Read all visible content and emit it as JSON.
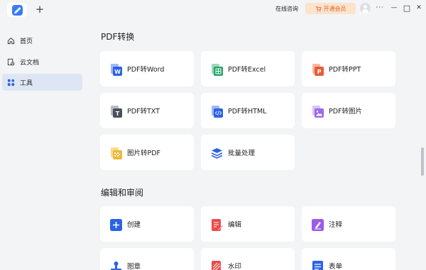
{
  "titlebar": {
    "new_tab": "+",
    "online_consult": "在线咨询",
    "vip_label": "开通会员",
    "more": "···",
    "minimize": "—",
    "maximize": "□",
    "close": "✕"
  },
  "sidebar": {
    "items": [
      {
        "label": "首页",
        "icon": "home-icon",
        "active": false
      },
      {
        "label": "云文档",
        "icon": "cloud-doc-icon",
        "active": false
      },
      {
        "label": "工具",
        "icon": "apps-grid-icon",
        "active": true
      }
    ]
  },
  "sections": [
    {
      "title": "PDF转换",
      "tools": [
        {
          "label": "PDF转Word",
          "icon": "word-icon",
          "color": "#2b62e6"
        },
        {
          "label": "PDF转Excel",
          "icon": "excel-icon",
          "color": "#21a366"
        },
        {
          "label": "PDF转PPT",
          "icon": "ppt-icon",
          "color": "#ec5b38"
        },
        {
          "label": "PDF转TXT",
          "icon": "txt-icon",
          "color": "#4a4f59"
        },
        {
          "label": "PDF转HTML",
          "icon": "html-icon",
          "color": "#2b62e6"
        },
        {
          "label": "PDF转图片",
          "icon": "image-icon",
          "color": "#9b6be6"
        },
        {
          "label": "图片转PDF",
          "icon": "image-to-pdf-icon",
          "color": "#f1b93a"
        },
        {
          "label": "批量处理",
          "icon": "batch-icon",
          "color": "#2b62e6"
        }
      ]
    },
    {
      "title": "编辑和审阅",
      "tools": [
        {
          "label": "创建",
          "icon": "create-icon",
          "color": "#2b62e6"
        },
        {
          "label": "编辑",
          "icon": "edit-icon",
          "color": "#ec4b4b"
        },
        {
          "label": "注释",
          "icon": "annotate-icon",
          "color": "#9b5be6"
        },
        {
          "label": "图章",
          "icon": "stamp-icon",
          "color": "#2b62e6"
        },
        {
          "label": "水印",
          "icon": "watermark-icon",
          "color": "#ec4b4b"
        },
        {
          "label": "表单",
          "icon": "form-icon",
          "color": "#2b62e6"
        }
      ]
    }
  ]
}
